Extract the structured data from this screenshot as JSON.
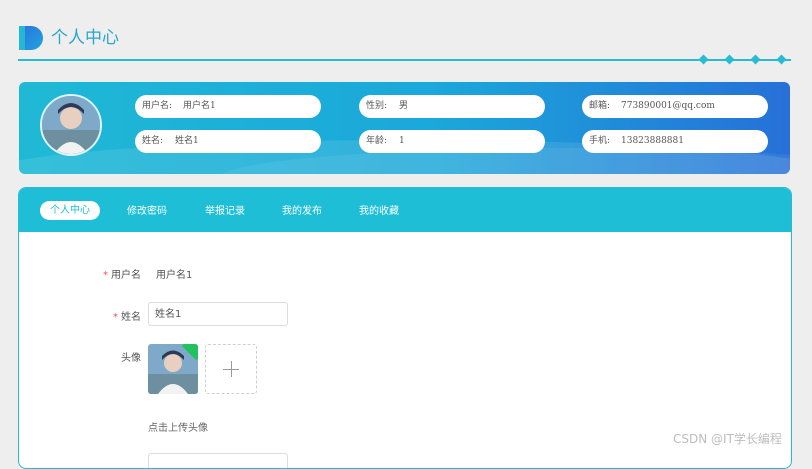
{
  "header": {
    "title": "个人中心"
  },
  "profile_banner": {
    "fields": [
      {
        "label": "用户名:",
        "value": "用户名1"
      },
      {
        "label": "性别:",
        "value": "男"
      },
      {
        "label": "邮箱:",
        "value": "773890001@qq.com"
      },
      {
        "label": "姓名:",
        "value": "姓名1"
      },
      {
        "label": "年龄:",
        "value": "1"
      },
      {
        "label": "手机:",
        "value": "13823888881"
      }
    ]
  },
  "tabs": [
    {
      "label": "个人中心",
      "active": true
    },
    {
      "label": "修改密码",
      "active": false
    },
    {
      "label": "举报记录",
      "active": false
    },
    {
      "label": "我的发布",
      "active": false
    },
    {
      "label": "我的收藏",
      "active": false
    }
  ],
  "form": {
    "required_mark": "*",
    "username": {
      "label": "用户名",
      "value": "用户名1"
    },
    "name": {
      "label": "姓名",
      "value": "姓名1"
    },
    "avatar": {
      "label": "头像",
      "upload_hint": "点击上传头像"
    }
  },
  "watermark": "CSDN @IT学长编程",
  "colors": {
    "accent": "#1ebfd6",
    "banner_end": "#2670d8",
    "title": "#29a5cf",
    "required": "#e55555"
  },
  "icons": {
    "add": "plus-icon",
    "title_mark": "title-marker-icon"
  }
}
